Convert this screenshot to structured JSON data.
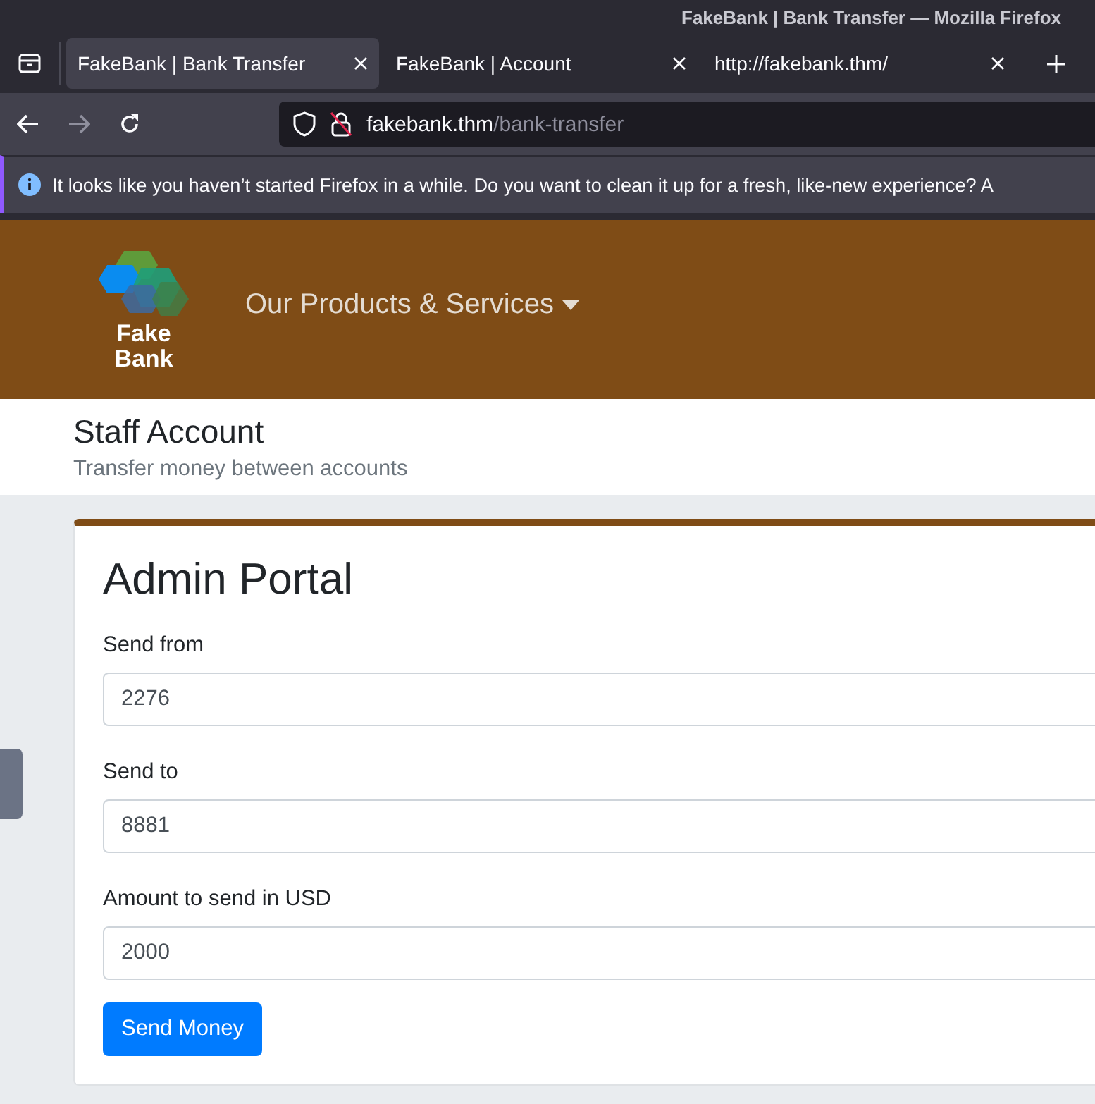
{
  "window": {
    "title": "FakeBank | Bank Transfer — Mozilla Firefox"
  },
  "tabs": [
    {
      "label": "FakeBank | Bank Transfer",
      "selected": true
    },
    {
      "label": "FakeBank | Account",
      "selected": false
    },
    {
      "label": "http://fakebank.thm/",
      "selected": false
    }
  ],
  "address_bar": {
    "host": "fakebank.thm",
    "path": "/bank-transfer"
  },
  "notification": {
    "text": "It looks like you haven’t started Firefox in a while. Do you want to clean it up for a fresh, like-new experience? A"
  },
  "site": {
    "logo_line_1": "Fake",
    "logo_line_2": "Bank",
    "nav_item": "Our Products & Services"
  },
  "page_header": {
    "title": "Staff Account",
    "subtitle": "Transfer money between accounts"
  },
  "card": {
    "title": "Admin Portal",
    "fields": [
      {
        "label": "Send from",
        "value": "2276"
      },
      {
        "label": "Send to",
        "value": "8881"
      },
      {
        "label": "Amount to send in USD",
        "value": "2000"
      }
    ],
    "button": "Send Money"
  }
}
